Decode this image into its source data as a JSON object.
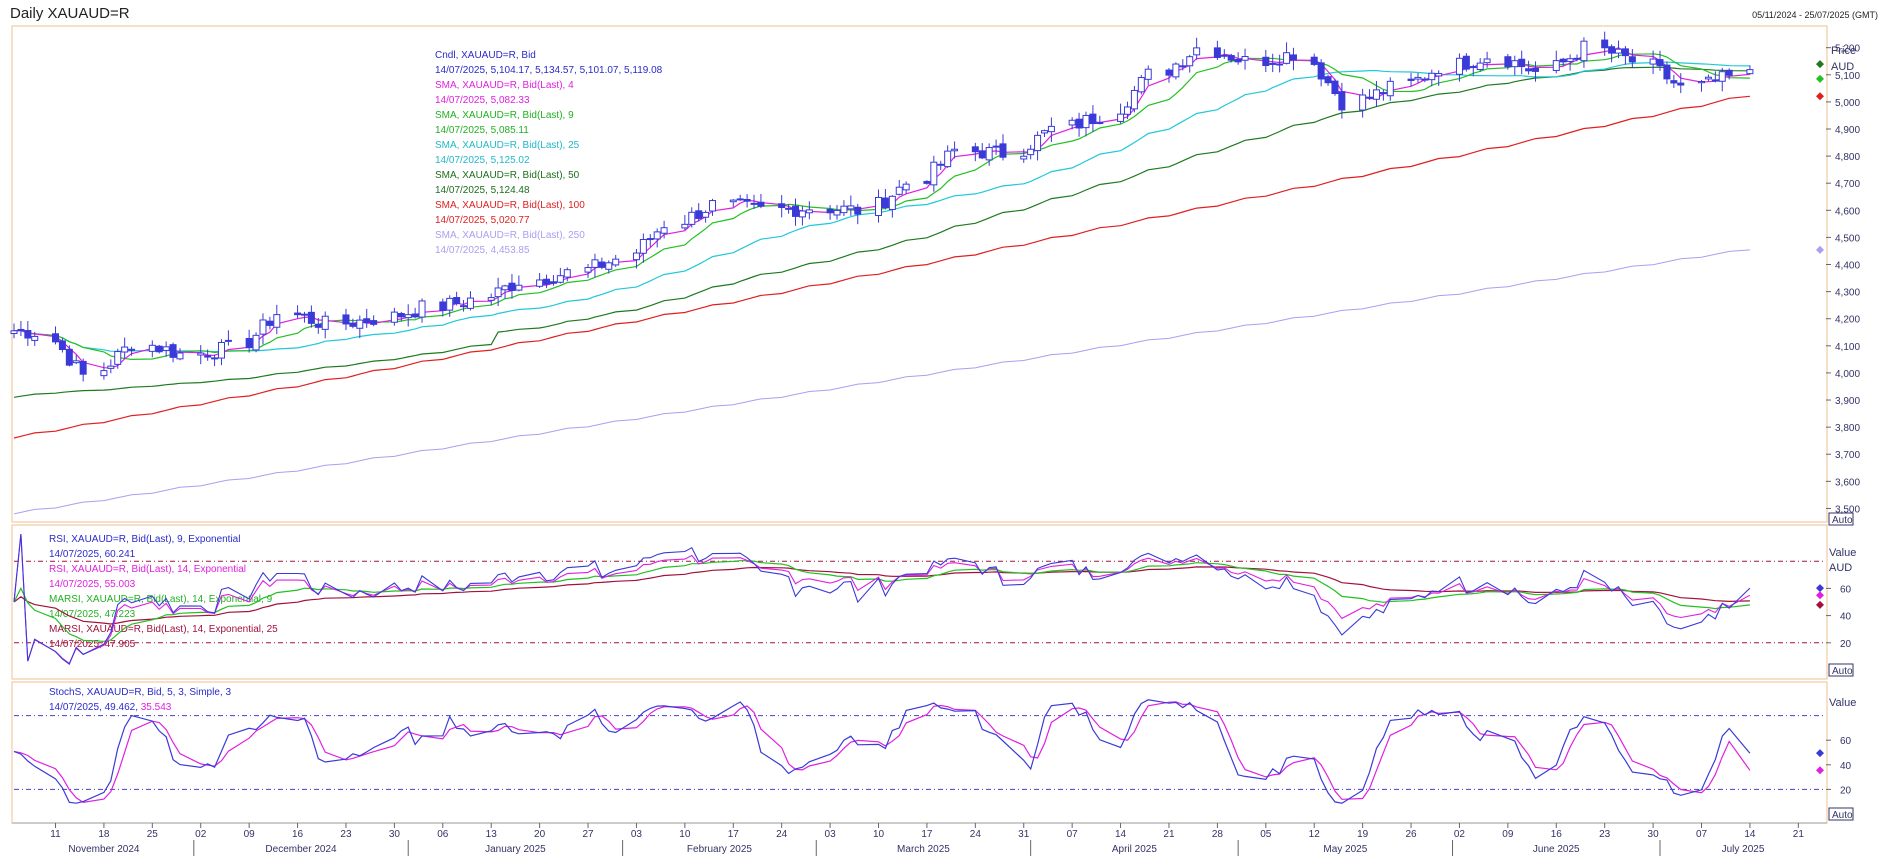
{
  "header": {
    "title": "Daily XAUAUD=R",
    "date_range": "05/11/2024 - 25/07/2025 (GMT)"
  },
  "colors": {
    "candle": "#3a3ad8",
    "sma4": "#e020e0",
    "sma9": "#22c022",
    "sma25": "#22c8d8",
    "sma50": "#1e7a1e",
    "sma100": "#e02020",
    "sma250": "#a8a0f0",
    "rsi9": "#3a3ad8",
    "rsi14": "#e020e0",
    "marsi9": "#22c022",
    "marsi14": "#a0123c",
    "stoch_k": "#3a3ad8",
    "stoch_d": "#e020e0",
    "panel_border": "#f0c090",
    "axis_text": "#333366"
  },
  "price_panel": {
    "axis_title": "Price",
    "axis_unit": "AUD",
    "auto_label": "Auto",
    "ticks": [
      "5,200",
      "5,100",
      "5,000",
      "4,900",
      "4,800",
      "4,700",
      "4,600",
      "4,500",
      "4,400",
      "4,300",
      "4,200",
      "4,100",
      "4,000",
      "3,900",
      "3,800",
      "3,700",
      "3,600",
      "3,500"
    ],
    "legend": [
      {
        "name": "Cndl, XAUAUD=R, Bid",
        "value": "14/07/2025, 5,104.17, 5,134.57, 5,101.07, 5,119.08",
        "color": "#2a2acc"
      },
      {
        "name": "SMA, XAUAUD=R, Bid(Last), 4",
        "value": "14/07/2025, 5,082.33",
        "color": "#e020e0"
      },
      {
        "name": "SMA, XAUAUD=R, Bid(Last), 9",
        "value": "14/07/2025, 5,085.11",
        "color": "#22b022"
      },
      {
        "name": "SMA, XAUAUD=R, Bid(Last), 25",
        "value": "14/07/2025, 5,125.02",
        "color": "#22b8c8"
      },
      {
        "name": "SMA, XAUAUD=R, Bid(Last), 50",
        "value": "14/07/2025, 5,124.48",
        "color": "#1e6e1e"
      },
      {
        "name": "SMA, XAUAUD=R, Bid(Last), 100",
        "value": "14/07/2025, 5,020.77",
        "color": "#e02020"
      },
      {
        "name": "SMA, XAUAUD=R, Bid(Last), 250",
        "value": "14/07/2025, 4,453.85",
        "color": "#a8a0f0"
      }
    ]
  },
  "rsi_panel": {
    "axis_title": "Value",
    "axis_unit": "AUD",
    "auto_label": "Auto",
    "ticks": [
      "60",
      "40",
      "20"
    ],
    "legend": [
      {
        "name": "RSI, XAUAUD=R, Bid(Last), 9, Exponential",
        "value": "14/07/2025, 60.241",
        "color": "#2a2acc"
      },
      {
        "name": "RSI, XAUAUD=R, Bid(Last), 14, Exponential",
        "value": "14/07/2025, 55.003",
        "color": "#e020e0"
      },
      {
        "name": "MARSI, XAUAUD=R, Bid(Last), 14, Exponential, 9",
        "value": "14/07/2025, 47.223",
        "color": "#22b022"
      },
      {
        "name": "MARSI, XAUAUD=R, Bid(Last), 14, Exponential, 25",
        "value": "14/07/2025, 47.905",
        "color": "#a0123c"
      }
    ]
  },
  "stoch_panel": {
    "axis_title": "Value",
    "auto_label": "Auto",
    "ticks": [
      "60",
      "40",
      "20"
    ],
    "legend_name": "StochS, XAUAUD=R, Bid,  5, 3, Simple, 3",
    "legend_value_date": "14/07/2025, 49.462, ",
    "legend_value_d": "35.543"
  },
  "x_axis": {
    "days": [
      "11",
      "18",
      "25",
      "02",
      "09",
      "16",
      "23",
      "30",
      "06",
      "13",
      "20",
      "27",
      "03",
      "10",
      "17",
      "24",
      "03",
      "10",
      "17",
      "24",
      "31",
      "07",
      "14",
      "21",
      "28",
      "05",
      "12",
      "19",
      "26",
      "02",
      "09",
      "16",
      "23",
      "30",
      "07",
      "14",
      "21"
    ],
    "months": [
      "November 2024",
      "December 2024",
      "January 2025",
      "February 2025",
      "March 2025",
      "April 2025",
      "May 2025",
      "June 2025",
      "July 2025"
    ]
  },
  "chart_data": [
    {
      "type": "candlestick",
      "title": "Daily XAUAUD=R",
      "ylabel": "Price AUD",
      "ylim": [
        3450,
        5280
      ],
      "x_range": [
        "2024-11-05",
        "2025-07-25"
      ],
      "weekly_close": [
        {
          "week": "2024-11-04",
          "close": 4150
        },
        {
          "week": "2024-11-11",
          "close": 3990
        },
        {
          "week": "2024-11-18",
          "close": 4110
        },
        {
          "week": "2024-11-25",
          "close": 4070
        },
        {
          "week": "2024-12-02",
          "close": 4090
        },
        {
          "week": "2024-12-09",
          "close": 4220
        },
        {
          "week": "2024-12-16",
          "close": 4180
        },
        {
          "week": "2024-12-23",
          "close": 4200
        },
        {
          "week": "2024-12-30",
          "close": 4240
        },
        {
          "week": "2025-01-06",
          "close": 4270
        },
        {
          "week": "2025-01-13",
          "close": 4340
        },
        {
          "week": "2025-01-20",
          "close": 4370
        },
        {
          "week": "2025-01-27",
          "close": 4420
        },
        {
          "week": "2025-02-03",
          "close": 4550
        },
        {
          "week": "2025-02-10",
          "close": 4620
        },
        {
          "week": "2025-02-17",
          "close": 4600
        },
        {
          "week": "2025-02-24",
          "close": 4610
        },
        {
          "week": "2025-03-03",
          "close": 4600
        },
        {
          "week": "2025-03-10",
          "close": 4700
        },
        {
          "week": "2025-03-17",
          "close": 4820
        },
        {
          "week": "2025-03-24",
          "close": 4810
        },
        {
          "week": "2025-03-31",
          "close": 4900
        },
        {
          "week": "2025-04-07",
          "close": 4950
        },
        {
          "week": "2025-04-14",
          "close": 5100
        },
        {
          "week": "2025-04-21",
          "close": 5200
        },
        {
          "week": "2025-04-28",
          "close": 5150
        },
        {
          "week": "2025-05-05",
          "close": 5180
        },
        {
          "week": "2025-05-12",
          "close": 5000
        },
        {
          "week": "2025-05-19",
          "close": 5050
        },
        {
          "week": "2025-05-26",
          "close": 5130
        },
        {
          "week": "2025-06-02",
          "close": 5170
        },
        {
          "week": "2025-06-09",
          "close": 5110
        },
        {
          "week": "2025-06-16",
          "close": 5200
        },
        {
          "week": "2025-06-23",
          "close": 5150
        },
        {
          "week": "2025-06-30",
          "close": 5050
        },
        {
          "week": "2025-07-07",
          "close": 5090
        },
        {
          "week": "2025-07-14",
          "close": 5119.08
        }
      ],
      "last_candle": {
        "date": "2025-07-14",
        "open": 5104.17,
        "high": 5134.57,
        "low": 5101.07,
        "close": 5119.08
      },
      "sma_last": {
        "4": 5082.33,
        "9": 5085.11,
        "25": 5125.02,
        "50": 5124.48,
        "100": 5020.77,
        "250": 4453.85
      },
      "sma100_start": 3760,
      "sma250_start": 3480,
      "sma50_start": 3910
    },
    {
      "type": "line",
      "title": "RSI",
      "ylim": [
        0,
        100
      ],
      "levels": [
        80,
        20
      ],
      "last_values": {
        "rsi9": 60.241,
        "rsi14": 55.003,
        "marsi9": 47.223,
        "marsi25": 47.905
      }
    },
    {
      "type": "line",
      "title": "StochS",
      "ylim": [
        0,
        100
      ],
      "levels": [
        80,
        20
      ],
      "last_values": {
        "k": 49.462,
        "d": 35.543
      }
    }
  ]
}
